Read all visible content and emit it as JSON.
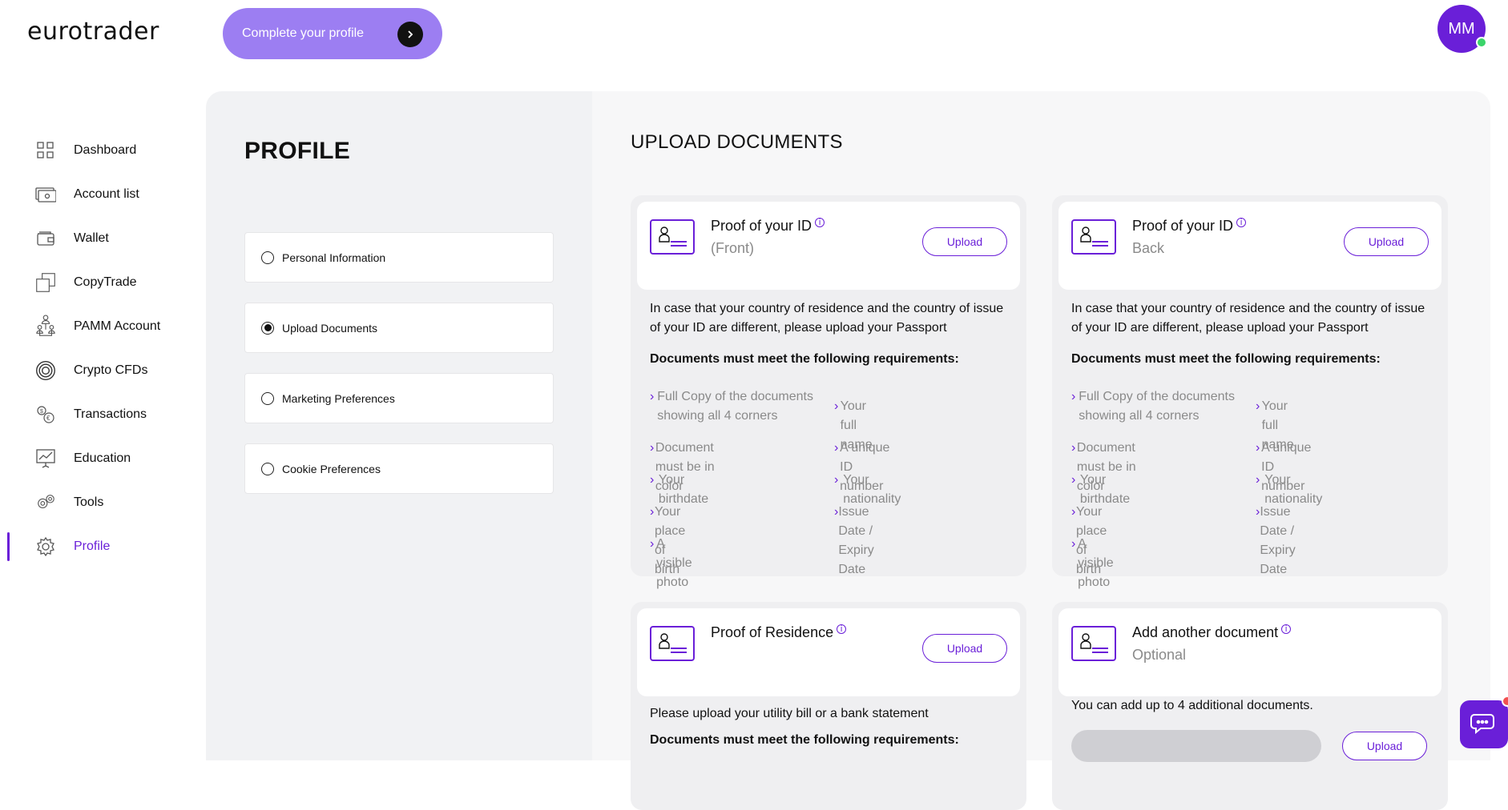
{
  "header": {
    "logo": "eurotrader",
    "complete_profile": "Complete your profile",
    "avatar_initials": "MM"
  },
  "sidebar": {
    "items": [
      {
        "label": "Dashboard",
        "icon": "grid-icon"
      },
      {
        "label": "Account list",
        "icon": "accounts-icon"
      },
      {
        "label": "Wallet",
        "icon": "wallet-icon"
      },
      {
        "label": "CopyTrade",
        "icon": "copy-icon"
      },
      {
        "label": "PAMM Account",
        "icon": "pamm-icon"
      },
      {
        "label": "Crypto CFDs",
        "icon": "crypto-icon"
      },
      {
        "label": "Transactions",
        "icon": "transactions-icon"
      },
      {
        "label": "Education",
        "icon": "education-icon"
      },
      {
        "label": "Tools",
        "icon": "tools-icon"
      },
      {
        "label": "Profile",
        "icon": "gear-icon"
      }
    ],
    "active": "Profile"
  },
  "profile": {
    "title": "PROFILE",
    "options": [
      {
        "label": "Personal Information",
        "selected": false
      },
      {
        "label": "Upload Documents",
        "selected": true
      },
      {
        "label": "Marketing Preferences",
        "selected": false
      },
      {
        "label": "Cookie Preferences",
        "selected": false
      }
    ]
  },
  "upload": {
    "title": "UPLOAD DOCUMENTS",
    "upload_label": "Upload",
    "info_mark": "i",
    "id_front": {
      "title": "Proof of your ID",
      "sub": "(Front)",
      "desc": "In case that your country of residence and the country of issue of your ID are different, please upload your Passport",
      "req_title": "Documents must meet the following requirements:",
      "req_left": [
        "Full Copy of the documents showing all 4 corners",
        "Document must be in color",
        "Your birthdate",
        "Your place of birth",
        "A visible photo"
      ],
      "req_right": [
        "Your full name",
        "A unique ID number",
        "Your nationality",
        "Issue Date / Expiry Date"
      ]
    },
    "id_back": {
      "title": "Proof of your ID",
      "sub": "Back",
      "desc": "In case that your country of residence and the country of issue of your ID are different, please upload your Passport",
      "req_title": "Documents must meet the following requirements:",
      "req_left": [
        "Full Copy of the documents showing all 4 corners",
        "Document must be in color",
        "Your birthdate",
        "Your place of birth",
        "A visible photo"
      ],
      "req_right": [
        "Your full name",
        "A unique ID number",
        "Your nationality",
        "Issue Date / Expiry Date"
      ]
    },
    "residence": {
      "title": "Proof of Residence",
      "desc": "Please upload your utility bill or a bank statement",
      "req_title": "Documents must meet the following requirements:"
    },
    "another": {
      "title": "Add another document",
      "sub": "Optional",
      "desc": "You can add up to 4 additional documents."
    }
  },
  "colors": {
    "accent": "#6a1fd8",
    "pill": "#9c7ef2",
    "online": "#3ad46a"
  }
}
